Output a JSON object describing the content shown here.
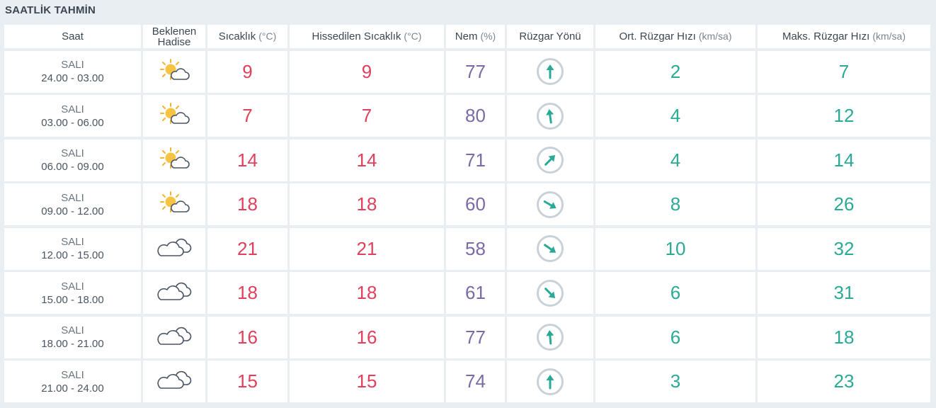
{
  "title": "SAATLİK TAHMİN",
  "colors": {
    "temperature": "#e0405c",
    "humidity": "#7c6aa8",
    "wind": "#2aaa94",
    "arrow": "#2aaa94"
  },
  "headers": {
    "saat": "Saat",
    "hadise_line1": "Beklenen",
    "hadise_line2": "Hadise",
    "sicaklik": "Sıcaklık",
    "sicaklik_unit": "(°C)",
    "hissedilen": "Hissedilen Sıcaklık",
    "hissedilen_unit": "(°C)",
    "nem": "Nem",
    "nem_unit": "(%)",
    "ruzgar_yonu": "Rüzgar Yönü",
    "ort_ruzgar": "Ort. Rüzgar Hızı",
    "ort_ruzgar_unit": "(km/sa)",
    "maks_ruzgar": "Maks. Rüzgar Hızı",
    "maks_ruzgar_unit": "(km/sa)"
  },
  "rows": [
    {
      "day": "SALI",
      "time": "24.00 - 03.00",
      "icon": "partly-cloudy-icon",
      "temp": "9",
      "feels": "9",
      "humidity": "77",
      "wind_dir_deg": 0,
      "wind_avg": "2",
      "wind_max": "7"
    },
    {
      "day": "SALI",
      "time": "03.00 - 06.00",
      "icon": "partly-cloudy-icon",
      "temp": "7",
      "feels": "7",
      "humidity": "80",
      "wind_dir_deg": -8,
      "wind_avg": "4",
      "wind_max": "12"
    },
    {
      "day": "SALI",
      "time": "06.00 - 09.00",
      "icon": "partly-cloudy-icon",
      "temp": "14",
      "feels": "14",
      "humidity": "71",
      "wind_dir_deg": 45,
      "wind_avg": "4",
      "wind_max": "14"
    },
    {
      "day": "SALI",
      "time": "09.00 - 12.00",
      "icon": "partly-cloudy-icon",
      "temp": "18",
      "feels": "18",
      "humidity": "60",
      "wind_dir_deg": 120,
      "wind_avg": "8",
      "wind_max": "26"
    },
    {
      "day": "SALI",
      "time": "12.00 - 15.00",
      "icon": "cloudy-icon",
      "temp": "21",
      "feels": "21",
      "humidity": "58",
      "wind_dir_deg": 125,
      "wind_avg": "10",
      "wind_max": "32"
    },
    {
      "day": "SALI",
      "time": "15.00 - 18.00",
      "icon": "cloudy-icon",
      "temp": "18",
      "feels": "18",
      "humidity": "61",
      "wind_dir_deg": 135,
      "wind_avg": "6",
      "wind_max": "31"
    },
    {
      "day": "SALI",
      "time": "18.00 - 21.00",
      "icon": "cloudy-icon",
      "temp": "16",
      "feels": "16",
      "humidity": "77",
      "wind_dir_deg": -5,
      "wind_avg": "6",
      "wind_max": "18"
    },
    {
      "day": "SALI",
      "time": "21.00 - 24.00",
      "icon": "cloudy-icon",
      "temp": "15",
      "feels": "15",
      "humidity": "74",
      "wind_dir_deg": 0,
      "wind_avg": "3",
      "wind_max": "23"
    }
  ]
}
